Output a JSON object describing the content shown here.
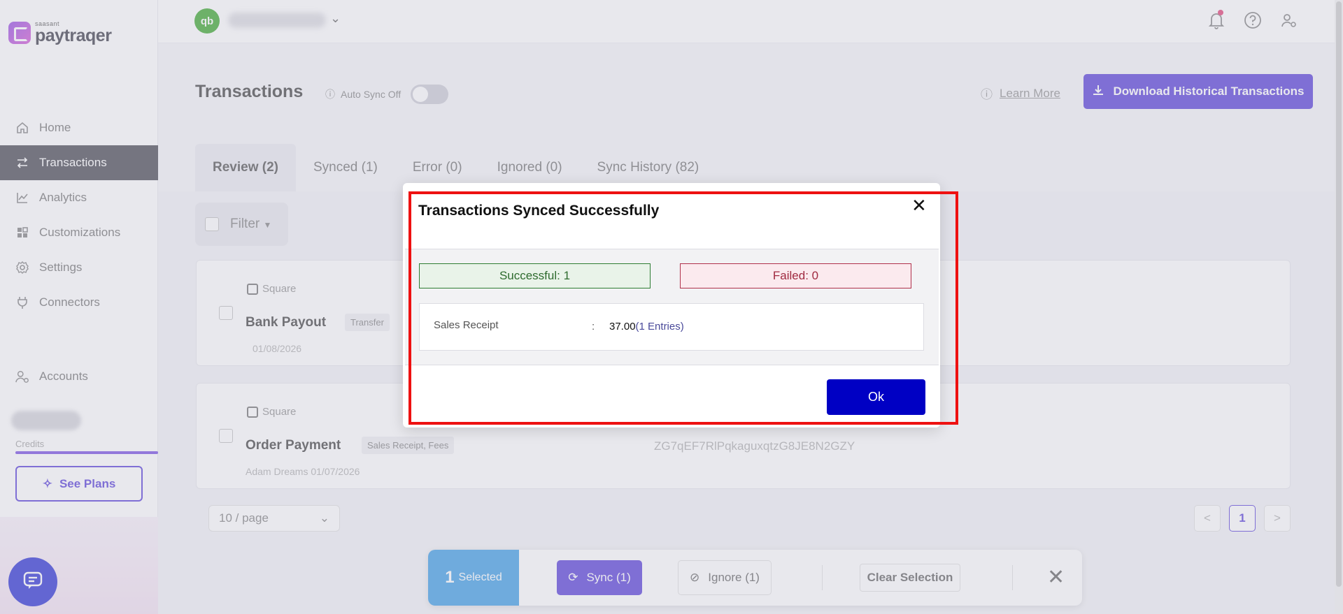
{
  "brand": {
    "small": "saasant",
    "name": "paytraqer"
  },
  "sidebar": {
    "items": [
      {
        "label": "Home",
        "icon": "home-icon"
      },
      {
        "label": "Transactions",
        "icon": "transfer-icon",
        "active": true
      },
      {
        "label": "Analytics",
        "icon": "chart-icon"
      },
      {
        "label": "Customizations",
        "icon": "grid-icon"
      },
      {
        "label": "Settings",
        "icon": "gear-icon"
      },
      {
        "label": "Connectors",
        "icon": "plug-icon"
      }
    ],
    "accounts_label": "Accounts",
    "credits_label": "Credits",
    "see_plans_label": "See Plans"
  },
  "header": {
    "qb_logo": "qb"
  },
  "page": {
    "title": "Transactions",
    "auto_sync_label": "Auto Sync Off",
    "learn_more": "Learn More",
    "download_label": "Download Historical Transactions"
  },
  "tabs": [
    {
      "label": "Review (2)",
      "active": true
    },
    {
      "label": "Synced (1)"
    },
    {
      "label": "Error (0)"
    },
    {
      "label": "Ignored (0)"
    },
    {
      "label": "Sync History (82)"
    }
  ],
  "filter_label": "Filter",
  "transactions": [
    {
      "source": "Square",
      "name": "Bank Payout",
      "tag": "Transfer",
      "meta": "01/08/2026",
      "id": ""
    },
    {
      "source": "Square",
      "name": "Order Payment",
      "tag": "Sales Receipt, Fees",
      "meta": "Adam Dreams  01/07/2026",
      "id": "ZG7qEF7RlPqkaguxqtzG8JE8N2GZY"
    }
  ],
  "pagination": {
    "page_size": "10 / page",
    "current_page": "1",
    "prev": "<",
    "next": ">"
  },
  "action_bar": {
    "selected_count": "1",
    "selected_label": "Selected",
    "sync_label": "Sync (1)",
    "ignore_label": "Ignore (1)",
    "clear_label": "Clear Selection",
    "close": "✕"
  },
  "modal": {
    "title": "Transactions Synced Successfully",
    "close": "✕",
    "successful": "Successful: 1",
    "failed": "Failed: 0",
    "result_label": "Sales Receipt",
    "result_colon": ":",
    "result_amount": "37.00",
    "result_entries": "(1 Entries)",
    "ok_label": "Ok"
  },
  "colors": {
    "accent": "#4a2fd6",
    "ok_button": "#0000c4",
    "highlight": "#ee1111",
    "success": "#2e7d32",
    "failed": "#b0304a"
  }
}
